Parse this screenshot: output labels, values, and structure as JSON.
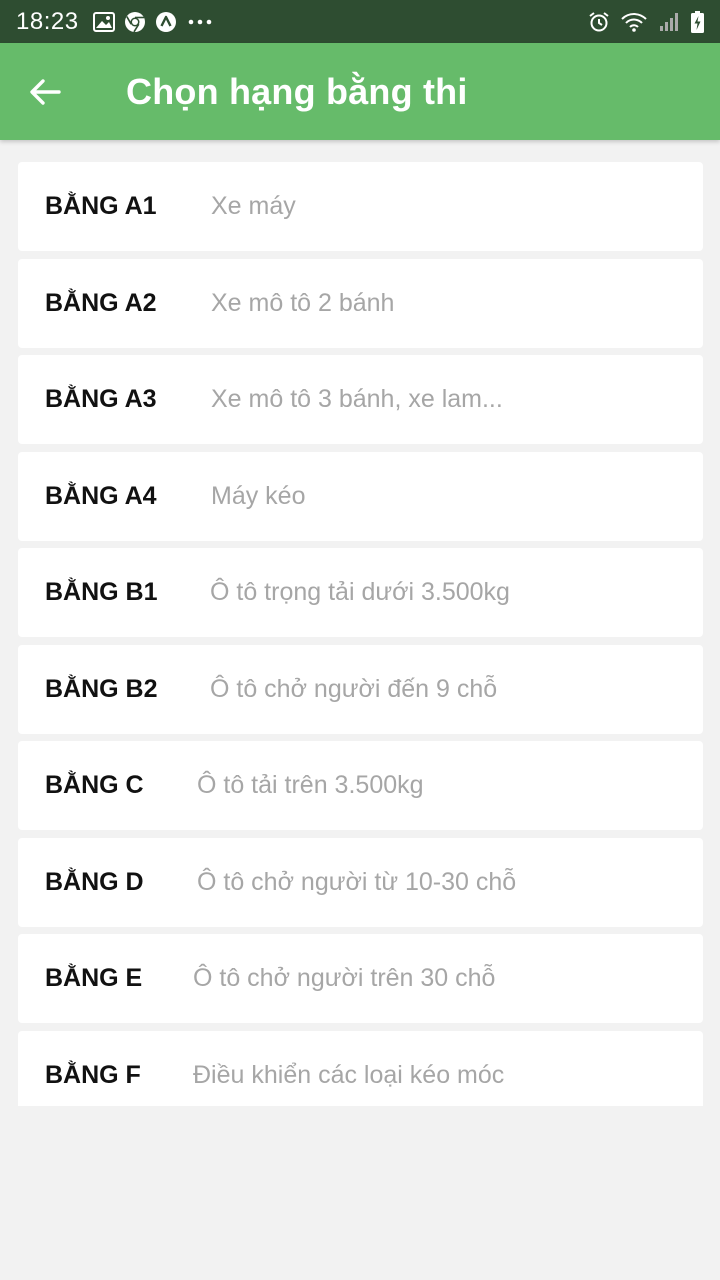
{
  "status_bar": {
    "time": "18:23",
    "left_icons": [
      "image-icon",
      "chrome-icon",
      "vpn-icon",
      "more-dots-icon"
    ],
    "right_icons": [
      "alarm-icon",
      "wifi-icon",
      "signal-icon",
      "battery-charging-icon"
    ]
  },
  "app_bar": {
    "title": "Chọn hạng bằng thi",
    "back_icon": "arrow-left-icon",
    "color": "#66bb6a"
  },
  "licenses": [
    {
      "name": "BẰNG A1",
      "desc": "Xe máy"
    },
    {
      "name": "BẰNG A2",
      "desc": "Xe mô tô 2 bánh"
    },
    {
      "name": "BẰNG A3",
      "desc": "Xe mô tô 3 bánh, xe lam..."
    },
    {
      "name": "BẰNG A4",
      "desc": "Máy kéo"
    },
    {
      "name": "BẰNG B1",
      "desc": "Ô tô trọng tải dưới 3.500kg"
    },
    {
      "name": "BẰNG B2",
      "desc": "Ô tô chở người đến 9 chỗ"
    },
    {
      "name": "BẰNG C",
      "desc": "Ô tô tải trên 3.500kg"
    },
    {
      "name": "BẰNG D",
      "desc": "Ô tô chở người từ 10-30 chỗ"
    },
    {
      "name": "BẰNG E",
      "desc": "Ô tô chở người trên 30 chỗ"
    },
    {
      "name": "BẰNG F",
      "desc": "Điều khiển các loại kéo móc"
    }
  ]
}
